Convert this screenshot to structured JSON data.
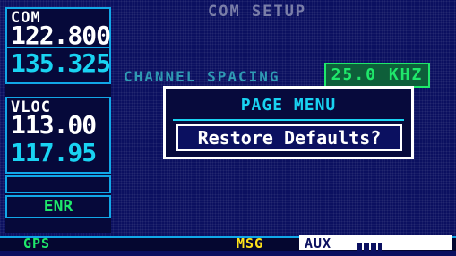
{
  "page": {
    "title": "COM SETUP"
  },
  "com": {
    "label": "COM",
    "active_freq": "122.800",
    "standby_freq": "135.325"
  },
  "vloc": {
    "label": "VLOC",
    "active_freq": "113.00",
    "standby_freq": "117.95"
  },
  "mode": {
    "label": "ENR"
  },
  "setting": {
    "label": "CHANNEL SPACING",
    "value": "25.0 KHZ"
  },
  "popup": {
    "heading": "PAGE MENU",
    "item": "Restore Defaults?"
  },
  "status_bar": {
    "gps": "GPS",
    "msg": "MSG",
    "aux": "AUX"
  },
  "colors": {
    "background": "#0b1060",
    "cyan": "#19d3f2",
    "green": "#1fe86b",
    "yellow": "#ffe21a"
  }
}
